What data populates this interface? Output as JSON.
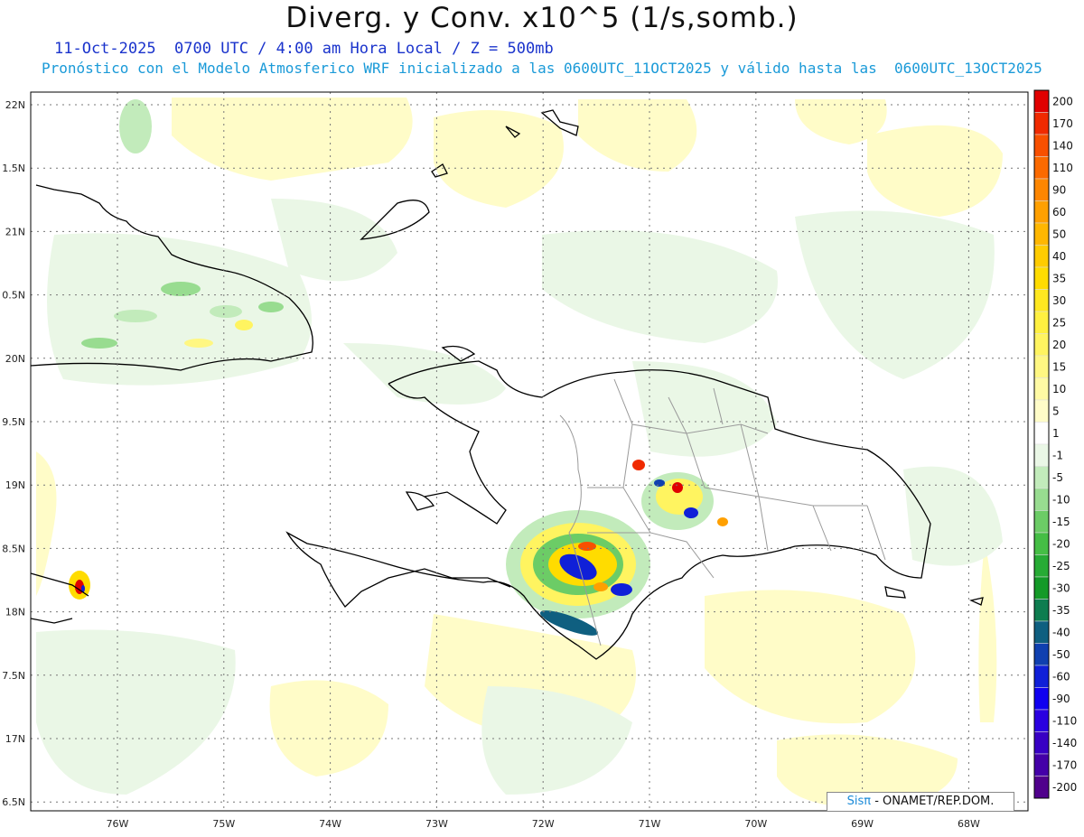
{
  "header": {
    "title": "Diverg. y Conv. x10^5 (1/s,somb.)",
    "date_line": "11-Oct-2025  0700 UTC / 4:00 am Hora Local / Z = 500mb",
    "forecast_line": "Pronóstico con el Modelo Atmosferico WRF inicializado a las 0600UTC_11OCT2025 y válido hasta las  0600UTC_13OCT2025"
  },
  "map": {
    "lon_labels": [
      "76W",
      "75W",
      "74W",
      "73W",
      "72W",
      "71W",
      "70W",
      "69W",
      "68W"
    ],
    "lat_labels": [
      "22N",
      "1.5N",
      "21N",
      "0.5N",
      "20N",
      "9.5N",
      "19N",
      "8.5N",
      "18N",
      "7.5N",
      "17N",
      "6.5N"
    ],
    "colors": {
      "coast": "#000000",
      "borders": "#9a9a9a",
      "grid": "#777777"
    }
  },
  "colorbar": {
    "labels": [
      "200",
      "170",
      "140",
      "110",
      "90",
      "60",
      "50",
      "40",
      "35",
      "30",
      "25",
      "20",
      "15",
      "10",
      "5",
      "1",
      "-1",
      "-5",
      "-10",
      "-15",
      "-20",
      "-25",
      "-30",
      "-35",
      "-40",
      "-50",
      "-60",
      "-90",
      "-110",
      "-140",
      "-170",
      "-200"
    ],
    "colors": [
      "#e00000",
      "#f02a00",
      "#f85000",
      "#fb6a00",
      "#fd8600",
      "#ffa000",
      "#ffb700",
      "#ffcc00",
      "#ffdc00",
      "#ffe820",
      "#fff040",
      "#fff460",
      "#fff782",
      "#fffaa4",
      "#fffcc8",
      "#ffffff",
      "#eaf7e6",
      "#c2ebbb",
      "#98dc90",
      "#6ccc66",
      "#45be45",
      "#27ab35",
      "#149a28",
      "#0e7d50",
      "#0f5f80",
      "#1040b0",
      "#1020d8",
      "#1000f0",
      "#2a00e0",
      "#3800c4",
      "#4400a8",
      "#50008c"
    ]
  },
  "credit": {
    "logo": "Sisπ",
    "text": " - ONAMET/REP.DOM."
  }
}
